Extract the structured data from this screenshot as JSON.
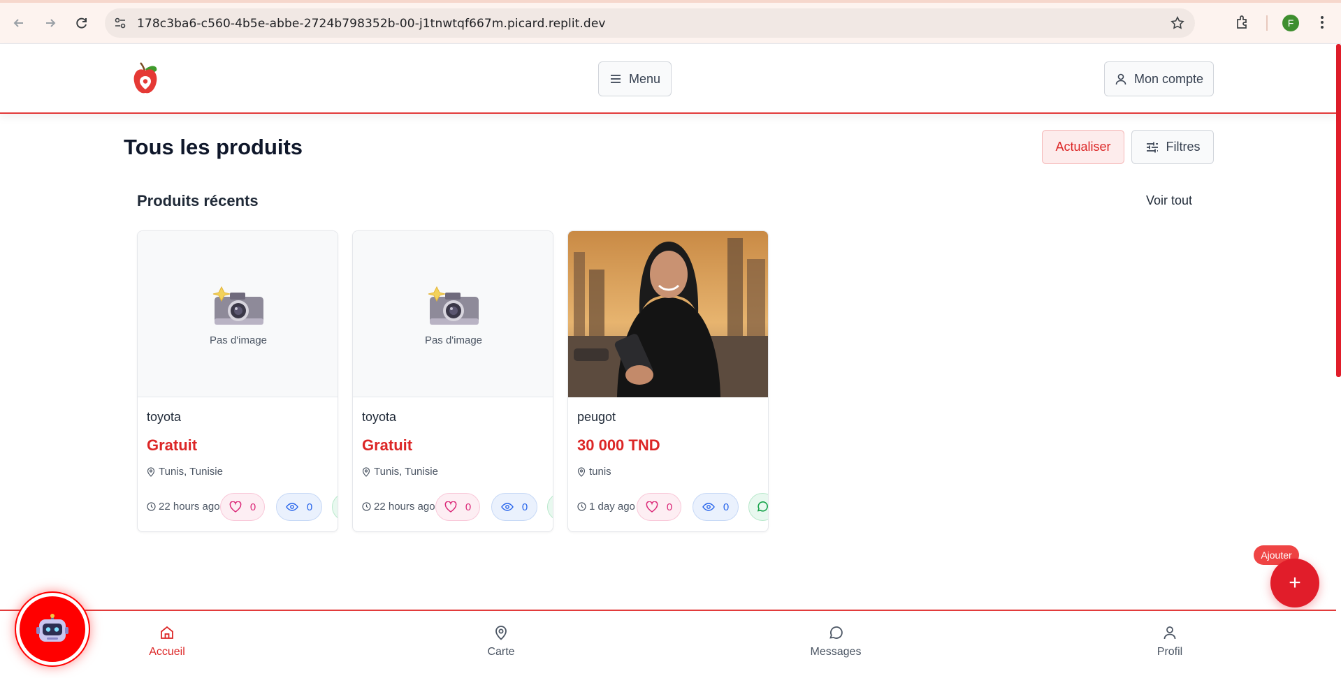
{
  "browser": {
    "url": "178c3ba6-c560-4b5e-abbe-2724b798352b-00-j1tnwtqf667m.picard.replit.dev",
    "profile_initial": "F"
  },
  "header": {
    "menu_label": "Menu",
    "account_label": "Mon compte"
  },
  "page": {
    "title": "Tous les produits",
    "refresh_label": "Actualiser",
    "filters_label": "Filtres"
  },
  "recent": {
    "title": "Produits récents",
    "see_all_label": "Voir tout",
    "products": [
      {
        "name": "toyota",
        "price": "Gratuit",
        "location": "Tunis, Tunisie",
        "time": "22 hours ago",
        "likes": "0",
        "views": "0",
        "image_placeholder": "Pas d'image"
      },
      {
        "name": "toyota",
        "price": "Gratuit",
        "location": "Tunis, Tunisie",
        "time": "22 hours ago",
        "likes": "0",
        "views": "0",
        "image_placeholder": "Pas d'image"
      },
      {
        "name": "peugot",
        "price": "30 000 TND",
        "location": "tunis",
        "time": "1 day ago",
        "likes": "0",
        "views": "0"
      }
    ]
  },
  "fab": {
    "add_label": "Ajouter",
    "add_icon": "+"
  },
  "bottom_nav": {
    "items": [
      {
        "label": "Accueil",
        "icon": "home-icon"
      },
      {
        "label": "Carte",
        "icon": "map-pin-icon"
      },
      {
        "label": "Messages",
        "icon": "message-icon"
      },
      {
        "label": "Profil",
        "icon": "user-icon"
      }
    ]
  },
  "colors": {
    "accent": "#dc2626",
    "brand_red": "#e11d2a"
  }
}
